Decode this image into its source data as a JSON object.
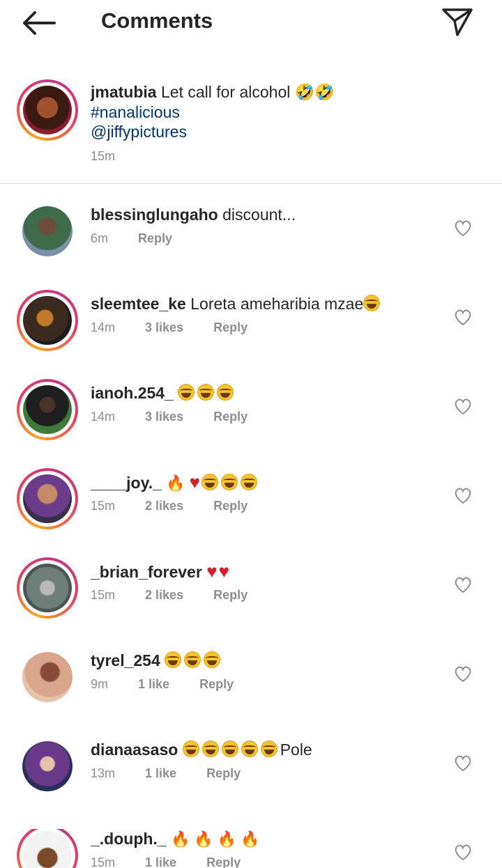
{
  "header": {
    "title": "Comments",
    "back_icon": "back-arrow-icon",
    "share_icon": "paper-plane-icon"
  },
  "caption": {
    "username": "jmatubia",
    "text": "Let call for alcohol",
    "emoji": "🤣🤣",
    "hashtag": "#nanalicious",
    "mention": "@jiffypictures",
    "time": "15m"
  },
  "comments": [
    {
      "username": "blessinglungaho",
      "text": "discount...",
      "time": "6m",
      "likes": "",
      "reply": "Reply"
    },
    {
      "username": "sleemtee_ke",
      "text": "Loreta ameharibia mzae",
      "emoji": "😂",
      "time": "14m",
      "likes": "3 likes",
      "reply": "Reply"
    },
    {
      "username": "ianoh.254_",
      "text": "",
      "emoji": "😂😂😂",
      "time": "14m",
      "likes": "3 likes",
      "reply": "Reply"
    },
    {
      "username": "____joy._",
      "text": "",
      "emoji": "🔥❤️😂😂😂",
      "time": "15m",
      "likes": "2 likes",
      "reply": "Reply"
    },
    {
      "username": "_brian_forever",
      "text": "",
      "emoji": "❤️❤️",
      "time": "15m",
      "likes": "2 likes",
      "reply": "Reply"
    },
    {
      "username": "tyrel_254",
      "text": "",
      "emoji": "😂😂😂",
      "time": "9m",
      "likes": "1 like",
      "reply": "Reply"
    },
    {
      "username": "dianaasaso",
      "text": "Pole",
      "emoji": "😂😂😂😂😂",
      "time": "13m",
      "likes": "1 like",
      "reply": "Reply"
    },
    {
      "username": "_.douph._",
      "text": "",
      "emoji": "🔥🔥🔥🔥",
      "time": "15m",
      "likes": "1 like",
      "reply": "Reply"
    }
  ],
  "colors": {
    "text": "#262626",
    "secondary": "#8e8e8e",
    "link": "#003569",
    "divider": "#dbdbdb",
    "ring_start": "#f5a623",
    "ring_end": "#c13584"
  }
}
